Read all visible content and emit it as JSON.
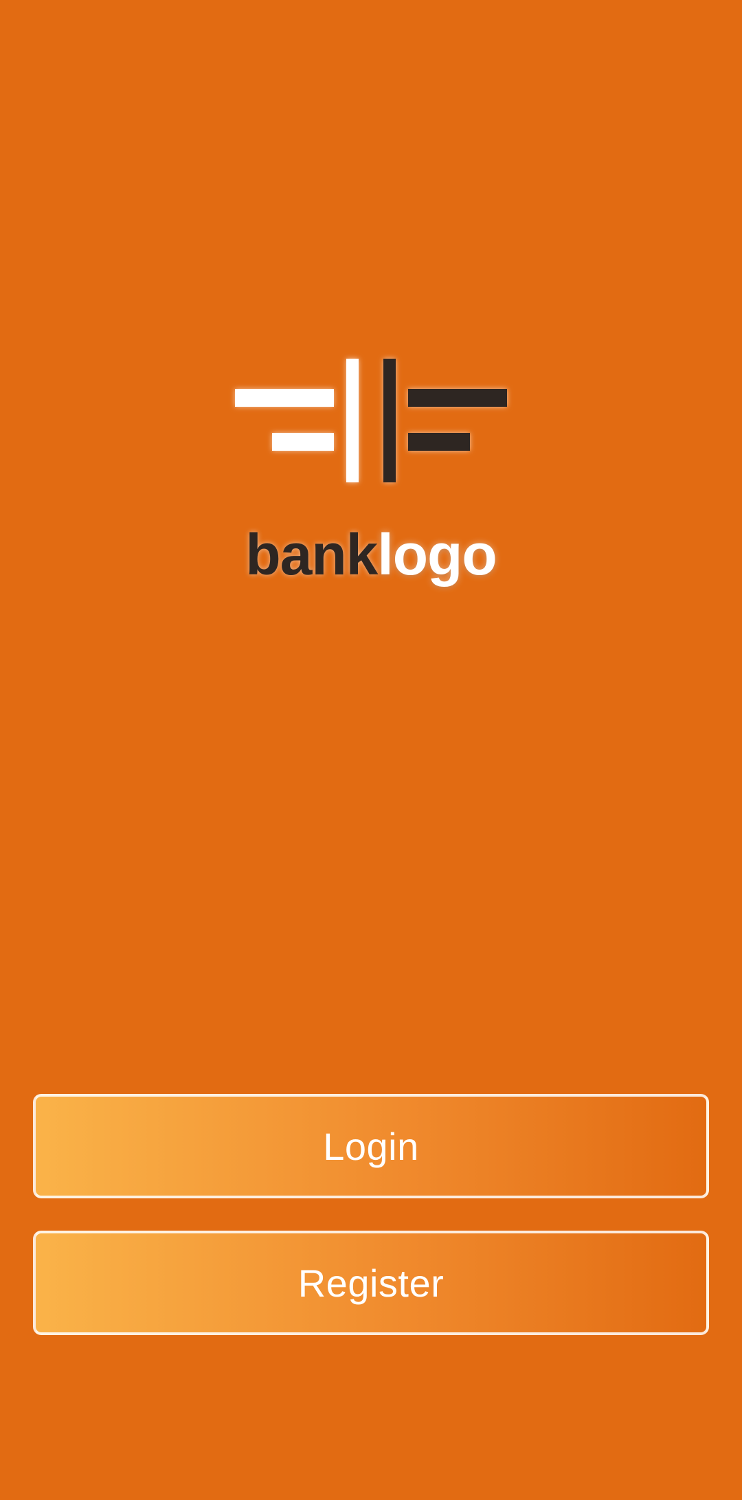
{
  "brand": {
    "name_part_dark": "bank",
    "name_part_light": "logo",
    "logo_icon": "bank-logo-mark-icon",
    "colors": {
      "background": "#E26B12",
      "dark": "#2E2622",
      "light": "#FFFFFF",
      "button_gradient_start": "#FAB349",
      "button_gradient_end": "#E26B12"
    }
  },
  "actions": {
    "login_label": "Login",
    "register_label": "Register"
  }
}
